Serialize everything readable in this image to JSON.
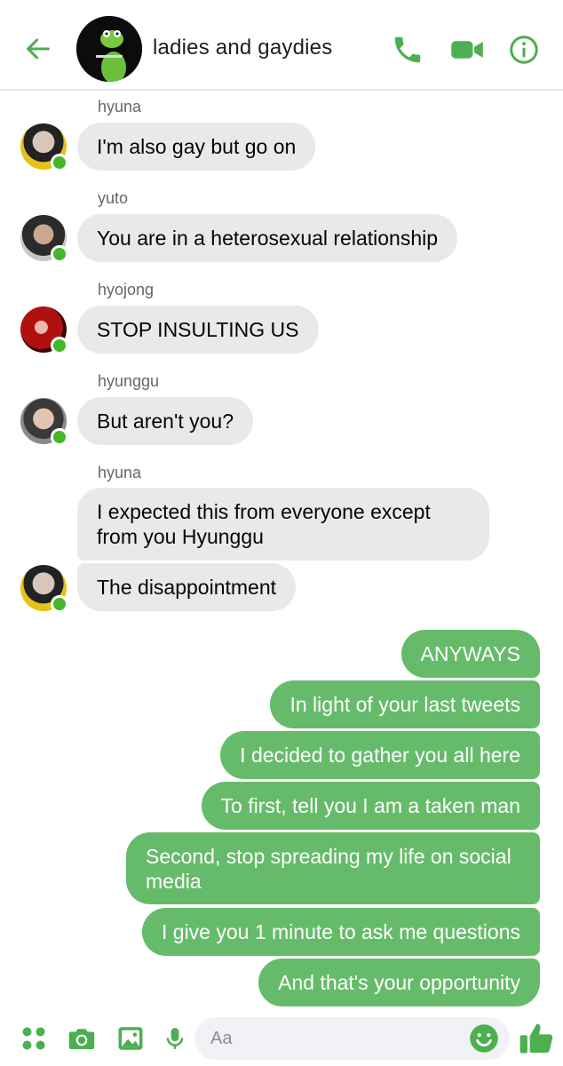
{
  "header": {
    "title": "ladies and gaydies",
    "icons": [
      "back-arrow-icon",
      "phone-icon",
      "video-icon",
      "info-icon"
    ]
  },
  "colors": {
    "accent": "#4caf50",
    "outgoing_bubble": "#66bb6a",
    "incoming_bubble": "#e9e9ea",
    "online": "#42b72a"
  },
  "messages": [
    {
      "sender": "hyuna",
      "text": "I'm also gay but go on",
      "direction": "incoming"
    },
    {
      "sender": "yuto",
      "text": "You are in a heterosexual relationship",
      "direction": "incoming"
    },
    {
      "sender": "hyojong",
      "text": "STOP INSULTING US",
      "direction": "incoming"
    },
    {
      "sender": "hyunggu",
      "text": "But aren't you?",
      "direction": "incoming"
    },
    {
      "sender": "hyuna",
      "text": "I expected this from everyone except from you Hyunggu",
      "direction": "incoming"
    },
    {
      "sender": "hyuna",
      "text": "The disappointment",
      "direction": "incoming"
    },
    {
      "text": "ANYWAYS",
      "direction": "outgoing"
    },
    {
      "text": "In light of your last tweets",
      "direction": "outgoing"
    },
    {
      "text": "I decided to gather you all here",
      "direction": "outgoing"
    },
    {
      "text": "To first, tell you I am a taken man",
      "direction": "outgoing"
    },
    {
      "text": "Second, stop spreading my life on social media",
      "direction": "outgoing"
    },
    {
      "text": "I give you 1 minute to ask me questions",
      "direction": "outgoing"
    },
    {
      "text": "And that's your opportunity",
      "direction": "outgoing"
    }
  ],
  "composer": {
    "placeholder": "Aa",
    "icons": [
      "apps-icon",
      "camera-icon",
      "gallery-icon",
      "microphone-icon",
      "emoji-icon",
      "thumbs-up-icon"
    ]
  }
}
